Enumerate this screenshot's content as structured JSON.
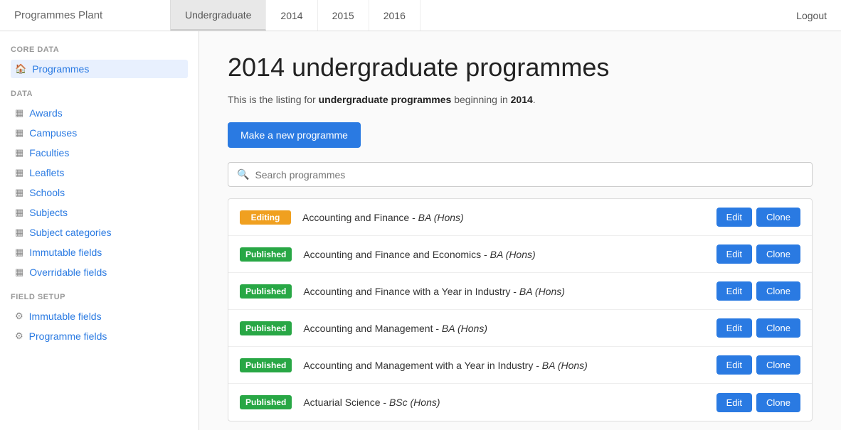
{
  "app": {
    "title": "Programmes Plant",
    "logout_label": "Logout"
  },
  "nav": {
    "tabs": [
      {
        "id": "undergraduate",
        "label": "Undergraduate",
        "active": true
      },
      {
        "id": "2014",
        "label": "2014",
        "active": false
      },
      {
        "id": "2015",
        "label": "2015",
        "active": false
      },
      {
        "id": "2016",
        "label": "2016",
        "active": false
      }
    ]
  },
  "sidebar": {
    "sections": [
      {
        "label": "CORE DATA",
        "items": [
          {
            "id": "programmes",
            "label": "Programmes",
            "icon": "🏠",
            "active": true
          }
        ]
      },
      {
        "label": "DATA",
        "items": [
          {
            "id": "awards",
            "label": "Awards",
            "icon": "☰"
          },
          {
            "id": "campuses",
            "label": "Campuses",
            "icon": "☰"
          },
          {
            "id": "faculties",
            "label": "Faculties",
            "icon": "☰"
          },
          {
            "id": "leaflets",
            "label": "Leaflets",
            "icon": "☰"
          },
          {
            "id": "schools",
            "label": "Schools",
            "icon": "☰"
          },
          {
            "id": "subjects",
            "label": "Subjects",
            "icon": "☰"
          },
          {
            "id": "subject-categories",
            "label": "Subject categories",
            "icon": "☰"
          },
          {
            "id": "immutable-fields",
            "label": "Immutable fields",
            "icon": "☰"
          },
          {
            "id": "overridable-fields",
            "label": "Overridable fields",
            "icon": "☰"
          }
        ]
      },
      {
        "label": "FIELD SETUP",
        "items": [
          {
            "id": "field-immutable",
            "label": "Immutable fields",
            "icon": "⚙"
          },
          {
            "id": "programme-fields",
            "label": "Programme fields",
            "icon": "⚙"
          }
        ]
      }
    ]
  },
  "main": {
    "page_title": "2014 undergraduate programmes",
    "description_prefix": "This is the listing for ",
    "description_bold1": "undergraduate programmes",
    "description_middle": " beginning in ",
    "description_bold2": "2014",
    "description_suffix": ".",
    "new_programme_label": "Make a new programme",
    "search_placeholder": "Search programmes",
    "programmes": [
      {
        "status": "Editing",
        "status_class": "badge-editing",
        "name_html": "Accounting and Finance - <em>BA (Hons)</em>"
      },
      {
        "status": "Published",
        "status_class": "badge-published",
        "name_html": "Accounting and Finance and Economics - <em>BA (Hons)</em>"
      },
      {
        "status": "Published",
        "status_class": "badge-published",
        "name_html": "Accounting and Finance with a Year in Industry - <em>BA (Hons)</em>"
      },
      {
        "status": "Published",
        "status_class": "badge-published",
        "name_html": "Accounting and Management - <em>BA (Hons)</em>"
      },
      {
        "status": "Published",
        "status_class": "badge-published",
        "name_html": "Accounting and Management with a Year in Industry - <em>BA (Hons)</em>"
      },
      {
        "status": "Published",
        "status_class": "badge-published",
        "name_html": "Actuarial Science - <em>BSc (Hons)</em>"
      }
    ],
    "edit_label": "Edit",
    "clone_label": "Clone"
  }
}
